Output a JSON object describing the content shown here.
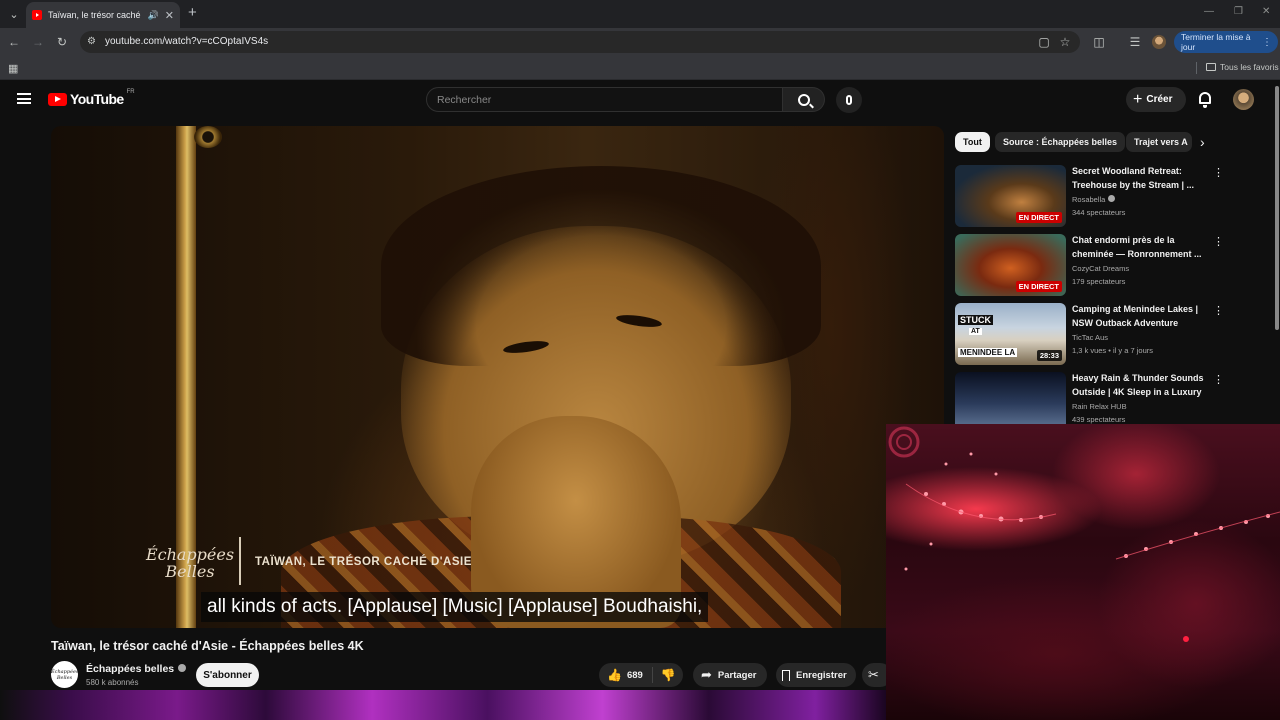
{
  "browser": {
    "tab_title": "Taïwan, le trésor caché d'Asie",
    "url": "youtube.com/watch?v=cCOptaIVS4s",
    "update_button": "Terminer la mise à jour",
    "bookmarks_folder": "Tous les favoris"
  },
  "header": {
    "logo_text": "YouTube",
    "country_code": "FR",
    "search_placeholder": "Rechercher",
    "create_label": "Créer"
  },
  "video": {
    "title": "Taïwan, le trésor caché d'Asie - Échappées belles 4K",
    "brand_logo_line1": "Échappées",
    "brand_logo_line2": "Belles",
    "overlay_title": "TAÏWAN, LE TRÉSOR CACHÉ D'ASIE",
    "subtitle": "all kinds of acts. [Applause] [Music] [Applause] Boudhaishi,"
  },
  "channel": {
    "name": "Échappées belles",
    "subscribers": "580 k abonnés",
    "avatar_text_1": "Échappées",
    "avatar_text_2": "Belles",
    "subscribe_label": "S'abonner"
  },
  "actions": {
    "likes": "689",
    "share_label": "Partager",
    "save_label": "Enregistrer"
  },
  "chips": [
    "Tout",
    "Source : Échappées belles",
    "Trajet vers A"
  ],
  "recommendations": [
    {
      "title": "Secret Woodland Retreat: Treehouse by the Stream | ...",
      "channel": "Rosabella",
      "verified": true,
      "meta": "344 spectateurs",
      "badge": "EN DIRECT",
      "badge_type": "live",
      "thumb_colors": [
        "#1b2a3a",
        "#5a3a1a",
        "#c08040"
      ]
    },
    {
      "title": "Chat endormi près de la cheminée — Ronronnement ...",
      "channel": "CozyCat Dreams",
      "verified": false,
      "meta": "179 spectateurs",
      "badge": "EN DIRECT",
      "badge_type": "live",
      "thumb_colors": [
        "#7a2a10",
        "#d06020",
        "#3a6a5a"
      ]
    },
    {
      "title": "Camping at Menindee Lakes | NSW Outback Adventure",
      "channel": "TicTac Aus",
      "verified": false,
      "meta": "1,3 k vues • il y a 7 jours",
      "badge": "28:33",
      "badge_type": "duration",
      "thumb_colors": [
        "#9ab0c8",
        "#d8d0c0",
        "#7a6a50"
      ],
      "thumb_text_1": "STUCK",
      "thumb_text_2": "AT",
      "thumb_text_3": "MENINDEE LA"
    },
    {
      "title": "Heavy Rain & Thunder Sounds Outside | 4K Sleep in a Luxury ...",
      "channel": "Rain Relax HUB",
      "verified": false,
      "meta": "439 spectateurs",
      "badge": "",
      "badge_type": "live",
      "thumb_colors": [
        "#0a1020",
        "#2a3a5a",
        "#6a80a0"
      ]
    }
  ]
}
